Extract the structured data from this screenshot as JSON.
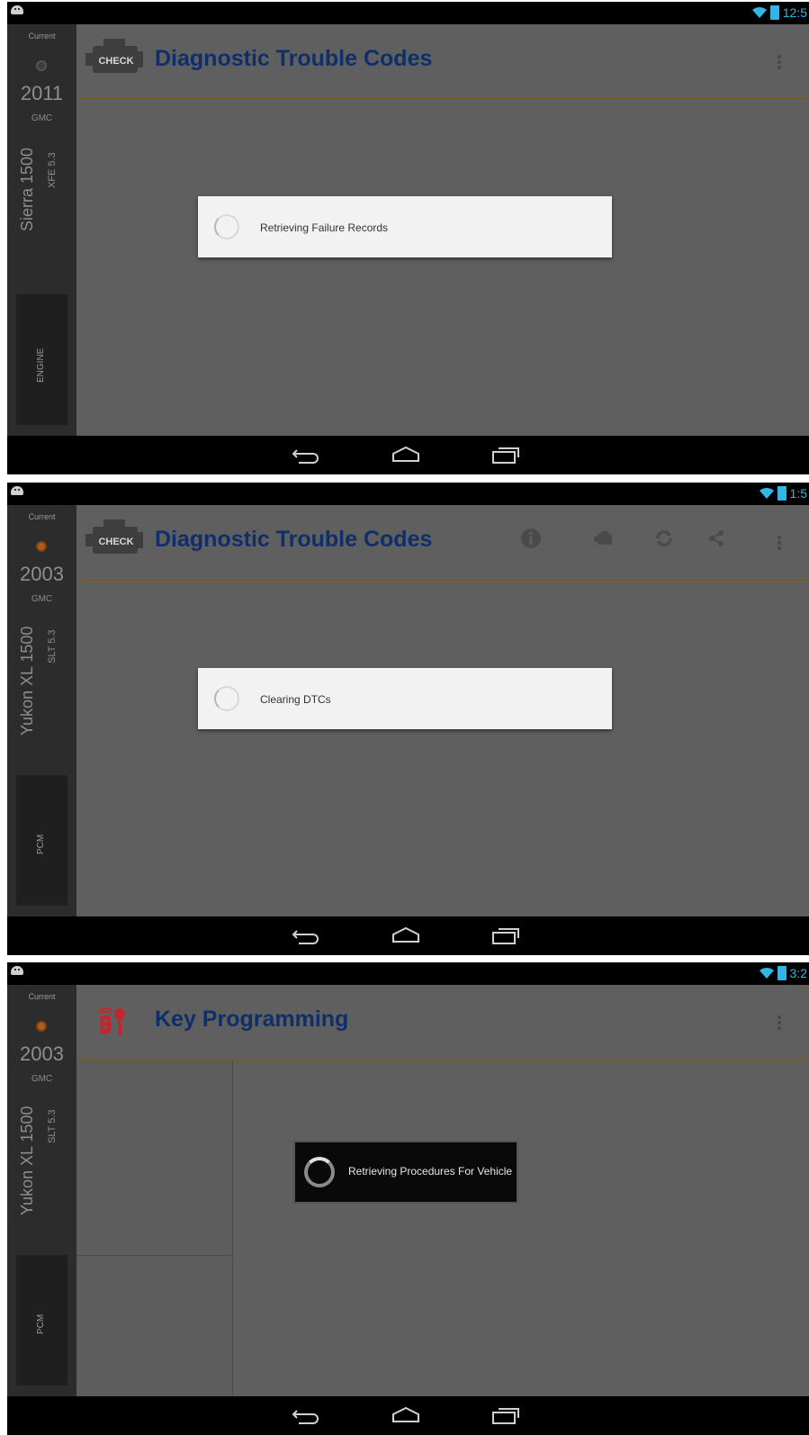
{
  "screens": [
    {
      "status_time": "12:5",
      "sidebar": {
        "current_label": "Current",
        "year": "2011",
        "make": "GMC",
        "model": "Sierra 1500",
        "trim": "XFE 5.3",
        "module": "ENGINE"
      },
      "header": {
        "title": "Diagnostic Trouble Codes",
        "icon_badge": "CHECK"
      },
      "dialog": {
        "message": "Retrieving Failure Records"
      }
    },
    {
      "status_time": "1:5",
      "sidebar": {
        "current_label": "Current",
        "year": "2003",
        "make": "GMC",
        "model": "Yukon XL 1500",
        "trim": "SLT 5.3",
        "module": "PCM"
      },
      "header": {
        "title": "Diagnostic Trouble Codes",
        "icon_badge": "CHECK"
      },
      "dialog": {
        "message": "Clearing DTCs"
      }
    },
    {
      "status_time": "3:2",
      "sidebar": {
        "current_label": "Current",
        "year": "2003",
        "make": "GMC",
        "model": "Yukon XL 1500",
        "trim": "SLT 5.3",
        "module": "PCM"
      },
      "header": {
        "title": "Key Programming"
      },
      "dialog": {
        "message": "Retrieving Procedures For Vehicle"
      }
    }
  ],
  "icons": {
    "status_left": "android-notification-icon",
    "status_right": [
      "wifi-icon",
      "battery-icon"
    ],
    "nav": [
      "back-icon",
      "home-icon",
      "recent-apps-icon"
    ],
    "header_actions_screen2": [
      "info-icon",
      "engine-icon",
      "refresh-icon",
      "share-icon",
      "overflow-menu-icon"
    ]
  },
  "colors": {
    "status_accent": "#33b5e5",
    "title": "#0f2f6b",
    "header_rule": "#7a5a20",
    "key_icon": "#c0282d"
  }
}
